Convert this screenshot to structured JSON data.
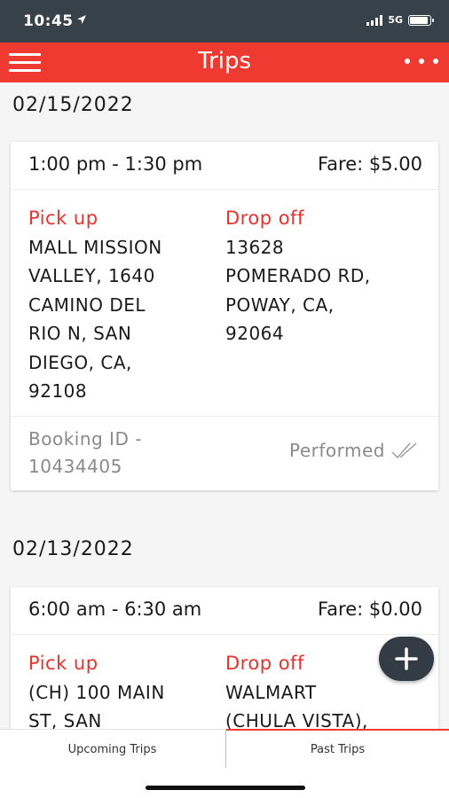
{
  "status_bar": {
    "time": "10:45",
    "network": "5G",
    "battery_level": 0.9
  },
  "app_bar": {
    "title": "Trips",
    "menu_icon": "hamburger-menu-icon",
    "more_icon": "more-dots-icon"
  },
  "trips": [
    {
      "date": "02/15/2022",
      "time": "1:00 pm - 1:30 pm",
      "fare": "Fare: $5.00",
      "pickup_label": "Pick up",
      "pickup_lines": [
        "MALL MISSION",
        "VALLEY, 1640",
        "CAMINO DEL",
        "RIO N, SAN",
        "DIEGO, CA,",
        "92108"
      ],
      "dropoff_label": "Drop off",
      "dropoff_lines": [
        "13628",
        "POMERADO RD,",
        "POWAY, CA,",
        "92064"
      ],
      "booking_lines": [
        "Booking ID -",
        "10434405"
      ],
      "status": "Performed"
    },
    {
      "date": "02/13/2022",
      "time": "6:00 am - 6:30 am",
      "fare": "Fare: $0.00",
      "pickup_label": "Pick up",
      "pickup_lines": [
        "(CH) 100 MAIN",
        "ST, SAN"
      ],
      "dropoff_label": "Drop off",
      "dropoff_lines": [
        "WALMART",
        "(CHULA VISTA),"
      ]
    }
  ],
  "fab": {
    "icon": "plus-icon"
  },
  "tabs": {
    "upcoming": "Upcoming Trips",
    "past": "Past Trips"
  },
  "colors": {
    "accent": "#ee3a31",
    "status_bar": "#37414a",
    "fab": "#333b44"
  }
}
